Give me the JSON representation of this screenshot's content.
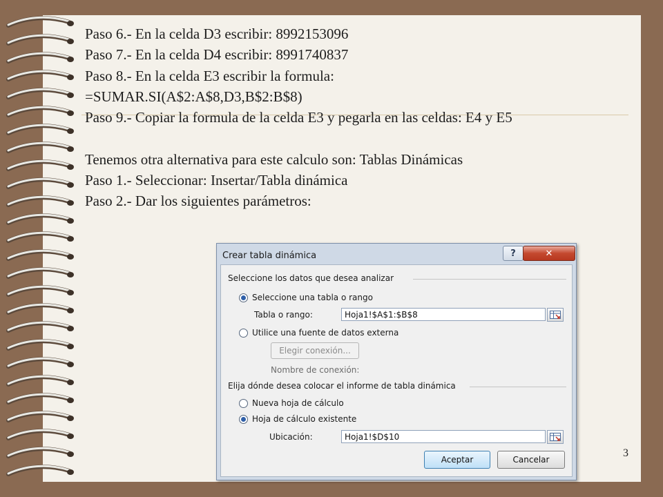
{
  "slide": {
    "lines": [
      "Paso 6.- En la celda D3 escribir:  8992153096",
      "Paso 7.- En la celda D4 escribir: 8991740837",
      "Paso 8.- En la celda E3 escribir la formula:",
      "=SUMAR.SI(A$2:A$8,D3,B$2:B$8)",
      "Paso 9.- Copiar la formula de la celda E3 y pegarla en las celdas: E4 y E5"
    ],
    "lines2": [
      "Tenemos otra alternativa para este calculo son: Tablas Dinámicas",
      "Paso 1.-  Seleccionar: Insertar/Tabla dinámica",
      "Paso 2.-  Dar los siguientes parámetros:"
    ],
    "page_number": "3"
  },
  "dialog": {
    "title": "Crear tabla dinámica",
    "help_label": "?",
    "close_label": "✕",
    "section1_label": "Seleccione los datos que desea analizar",
    "radio_table_label": "Seleccione una tabla o rango",
    "range_label": "Tabla o rango:",
    "range_value": "Hoja1!$A$1:$B$8",
    "radio_external_label": "Utilice una fuente de datos externa",
    "choose_connection_label": "Elegir conexión...",
    "connection_name_label": "Nombre de conexión:",
    "section2_label": "Elija dónde desea colocar el informe de tabla dinámica",
    "radio_new_sheet_label": "Nueva hoja de cálculo",
    "radio_existing_sheet_label": "Hoja de cálculo existente",
    "location_label": "Ubicación:",
    "location_value": "Hoja1!$D$10",
    "ok_label": "Aceptar",
    "cancel_label": "Cancelar",
    "selected_source": "table",
    "selected_destination": "existing"
  },
  "icons": [
    "spiral-ring-icon",
    "range-picker-icon",
    "help-icon",
    "close-icon"
  ],
  "colors": {
    "background": "#8a6a52",
    "paper": "#f4f1ea",
    "dialog_frame": "#cfd9e6",
    "accent": "#2f5fa8"
  }
}
